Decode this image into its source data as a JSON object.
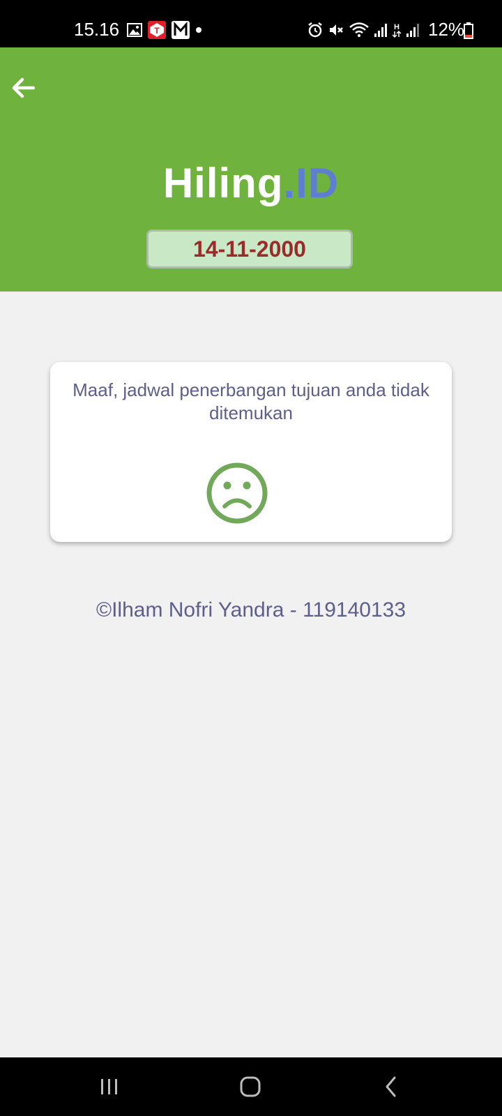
{
  "status_bar": {
    "time": "15.16",
    "battery_text": "12%",
    "left_icons": [
      "gallery-icon",
      "telkomsel-app-icon",
      "m-app-icon",
      "dot-icon"
    ],
    "right_icons": [
      "alarm-icon",
      "mute-icon",
      "wifi-icon",
      "signal-icon",
      "data-h-icon",
      "signal-icon-2",
      "battery-icon"
    ]
  },
  "header": {
    "brand_main": "Hiling",
    "brand_suffix": ".ID",
    "date": "14-11-2000"
  },
  "result": {
    "message": "Maaf, jadwal penerbangan tujuan anda tidak ditemukan",
    "icon": "sad-face-icon"
  },
  "footer": {
    "copyright": "©Ilham Nofri Yandra - 119140133"
  },
  "colors": {
    "header_bg": "#70b23e",
    "brand_suffix": "#5e7fd0",
    "date_badge_bg": "#c9e8c6",
    "date_text": "#9a2b2b",
    "text_muted": "#5d5e8c",
    "icon_green": "#72a85a",
    "page_bg": "#f1f1f1"
  }
}
